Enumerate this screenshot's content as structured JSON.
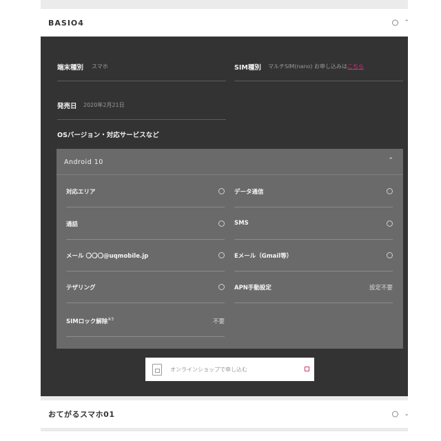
{
  "section1": {
    "title": "BASIO4"
  },
  "details": {
    "device_type": {
      "label": "端末種別",
      "value": "スマホ"
    },
    "sim_type": {
      "label": "SIM種別",
      "value": "マルチSIM(nano) お申し込みは",
      "link": "こちら"
    },
    "release_date": {
      "label": "発売日",
      "value": "2020年2月21日"
    },
    "os_section_label": "OSバージョン・対応サービスなど"
  },
  "panel": {
    "title": "Android 10",
    "items": [
      {
        "label": "対応エリア",
        "value": ""
      },
      {
        "label": "データ通信",
        "value": ""
      },
      {
        "label": "通話",
        "value": ""
      },
      {
        "label": "SMS",
        "value": ""
      },
      {
        "label": "メール 〇〇〇@uqmobile.jp",
        "value": ""
      },
      {
        "label": "Eメール（Gmail等）",
        "value": ""
      },
      {
        "label": "テザリング",
        "value": ""
      },
      {
        "label": "APN手動設定",
        "value": "設定不要"
      },
      {
        "label": "SIMロック解除",
        "note": "※3",
        "value": "不要"
      }
    ]
  },
  "shop_button": {
    "label": "オンラインショップで申し込む"
  },
  "section2": {
    "title": "おてがるスマホ01"
  }
}
